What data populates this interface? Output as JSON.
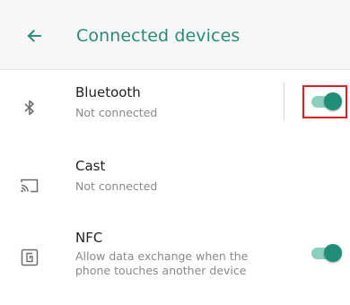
{
  "header": {
    "title": "Connected devices",
    "back_icon": "arrow-left-icon"
  },
  "colors": {
    "accent": "#2a8c78",
    "toggle_thumb": "#1f8f79",
    "toggle_track": "#8ccfbe",
    "highlight": "#e02020"
  },
  "items": [
    {
      "title": "Bluetooth",
      "subtitle": "Not connected",
      "icon": "bluetooth-icon",
      "toggle": true,
      "toggle_on": true
    },
    {
      "title": "Cast",
      "subtitle": "Not connected",
      "icon": "cast-icon",
      "toggle": false
    },
    {
      "title": "NFC",
      "subtitle": "Allow data exchange when the phone touches another device",
      "icon": "nfc-icon",
      "toggle": true,
      "toggle_on": true
    }
  ]
}
